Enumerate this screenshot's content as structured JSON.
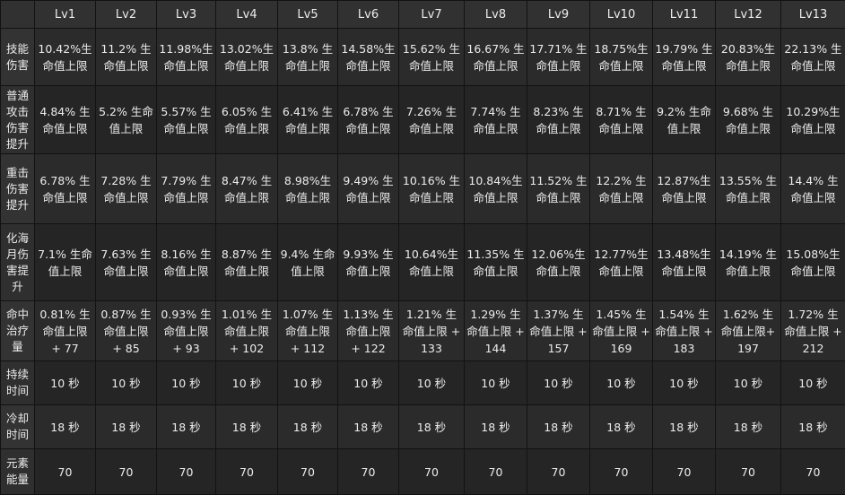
{
  "table": {
    "corner": "",
    "headers": [
      "Lv1",
      "Lv2",
      "Lv3",
      "Lv4",
      "Lv5",
      "Lv6",
      "Lv7",
      "Lv8",
      "Lv9",
      "Lv10",
      "Lv11",
      "Lv12",
      "Lv13"
    ],
    "rows": [
      {
        "label": "技能伤害",
        "cells": [
          "10.42%生命值上限",
          "11.2% 生命值上限",
          "11.98%生命值上限",
          "13.02%生命值上限",
          "13.8% 生命值上限",
          "14.58%生命值上限",
          "15.62% 生命值上限",
          "16.67% 生命值上限",
          "17.71% 生命值上限",
          "18.75%生命值上限",
          "19.79% 生命值上限",
          "20.83%生命值上限",
          "22.13% 生命值上限"
        ]
      },
      {
        "label": "普通攻击伤害提升",
        "cells": [
          "4.84% 生命值上限",
          "5.2% 生命值上限",
          "5.57% 生命值上限",
          "6.05% 生命值上限",
          "6.41% 生命值上限",
          "6.78% 生命值上限",
          "7.26% 生命值上限",
          "7.74% 生命值上限",
          "8.23% 生命值上限",
          "8.71% 生命值上限",
          "9.2% 生命值上限",
          "9.68% 生命值上限",
          "10.29%生命值上限"
        ]
      },
      {
        "label": "重击伤害提升",
        "cells": [
          "6.78% 生命值上限",
          "7.28% 生命值上限",
          "7.79% 生命值上限",
          "8.47% 生命值上限",
          "8.98%生命值上限",
          "9.49% 生命值上限",
          "10.16% 生命值上限",
          "10.84%生命值上限",
          "11.52% 生命值上限",
          "12.2% 生命值上限",
          "12.87%生命值上限",
          "13.55% 生命值上限",
          "14.4% 生命值上限"
        ]
      },
      {
        "label": "化海月伤害提升",
        "cells": [
          "7.1% 生命值上限",
          "7.63% 生命值上限",
          "8.16% 生命值上限",
          "8.87% 生命值上限",
          "9.4% 生命值上限",
          "9.93% 生命值上限",
          "10.64%生命值上限",
          "11.35% 生命值上限",
          "12.06%生命值上限",
          "12.77%生命值上限",
          "13.48%生命值上限",
          "14.19% 生命值上限",
          "15.08%生命值上限"
        ]
      },
      {
        "label": "命中治疗量",
        "cells": [
          "0.81% 生命值上限 + 77",
          "0.87% 生命值上限 + 85",
          "0.93% 生命值上限 + 93",
          "1.01% 生命值上限 + 102",
          "1.07% 生命值上限 + 112",
          "1.13% 生命值上限 + 122",
          "1.21% 生命值上限 + 133",
          "1.29% 生命值上限 + 144",
          "1.37% 生命值上限 + 157",
          "1.45% 生命值上限 + 169",
          "1.54% 生命值上限 + 183",
          "1.62% 生命值上限+ 197",
          "1.72% 生命值上限 + 212"
        ]
      },
      {
        "label": "持续时间",
        "cells": [
          "10 秒",
          "10 秒",
          "10 秒",
          "10 秒",
          "10 秒",
          "10 秒",
          "10 秒",
          "10 秒",
          "10 秒",
          "10 秒",
          "10 秒",
          "10 秒",
          "10 秒"
        ]
      },
      {
        "label": "冷却时间",
        "cells": [
          "18 秒",
          "18 秒",
          "18 秒",
          "18 秒",
          "18 秒",
          "18 秒",
          "18 秒",
          "18 秒",
          "18 秒",
          "18 秒",
          "18 秒",
          "18 秒",
          "18 秒"
        ]
      },
      {
        "label": "元素能量",
        "cells": [
          "70",
          "70",
          "70",
          "70",
          "70",
          "70",
          "70",
          "70",
          "70",
          "70",
          "70",
          "70",
          "70"
        ]
      }
    ]
  }
}
